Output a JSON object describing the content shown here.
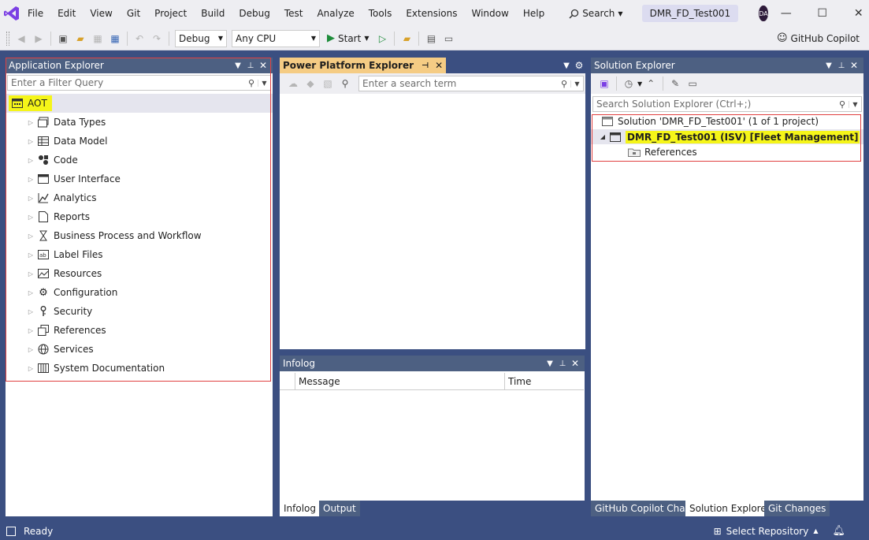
{
  "menu": {
    "items": [
      "File",
      "Edit",
      "View",
      "Git",
      "Project",
      "Build",
      "Debug",
      "Test",
      "Analyze",
      "Tools",
      "Extensions",
      "Window",
      "Help"
    ],
    "search_label": "Search",
    "solution_title": "DMR_FD_Test001",
    "avatar_initials": "DA"
  },
  "toolbar": {
    "config": "Debug",
    "platform": "Any CPU",
    "start_label": "Start",
    "copilot_label": "GitHub Copilot"
  },
  "app_explorer": {
    "title": "Application Explorer",
    "filter_placeholder": "Enter a Filter Query",
    "root": "AOT",
    "items": [
      {
        "label": "Data Types",
        "icon": "data-types-icon"
      },
      {
        "label": "Data Model",
        "icon": "data-model-icon"
      },
      {
        "label": "Code",
        "icon": "code-icon"
      },
      {
        "label": "User Interface",
        "icon": "user-interface-icon"
      },
      {
        "label": "Analytics",
        "icon": "analytics-icon"
      },
      {
        "label": "Reports",
        "icon": "reports-icon"
      },
      {
        "label": "Business Process and Workflow",
        "icon": "workflow-icon"
      },
      {
        "label": "Label Files",
        "icon": "label-files-icon"
      },
      {
        "label": "Resources",
        "icon": "resources-icon"
      },
      {
        "label": "Configuration",
        "icon": "configuration-icon"
      },
      {
        "label": "Security",
        "icon": "security-icon"
      },
      {
        "label": "References",
        "icon": "references-icon"
      },
      {
        "label": "Services",
        "icon": "services-icon"
      },
      {
        "label": "System Documentation",
        "icon": "system-documentation-icon"
      }
    ]
  },
  "power_platform": {
    "title": "Power Platform Explorer",
    "search_placeholder": "Enter a search term"
  },
  "infolog": {
    "title": "Infolog",
    "columns": [
      "Message",
      "Time"
    ],
    "tabs": [
      "Infolog",
      "Output"
    ]
  },
  "solution_explorer": {
    "title": "Solution Explorer",
    "search_placeholder": "Search Solution Explorer (Ctrl+;)",
    "solution_label": "Solution 'DMR_FD_Test001' (1 of 1 project)",
    "project_label": "DMR_FD_Test001 (ISV) [Fleet Management]",
    "references_label": "References",
    "tabs": [
      "GitHub Copilot Chat",
      "Solution Explorer",
      "Git Changes"
    ]
  },
  "status": {
    "ready": "Ready",
    "select_repo": "Select Repository"
  },
  "colors": {
    "panel_header": "#4d6082",
    "background": "#3b4f81",
    "highlight": "#f5f519",
    "active_tab": "#f5cc84",
    "red_outline": "#e04040"
  }
}
